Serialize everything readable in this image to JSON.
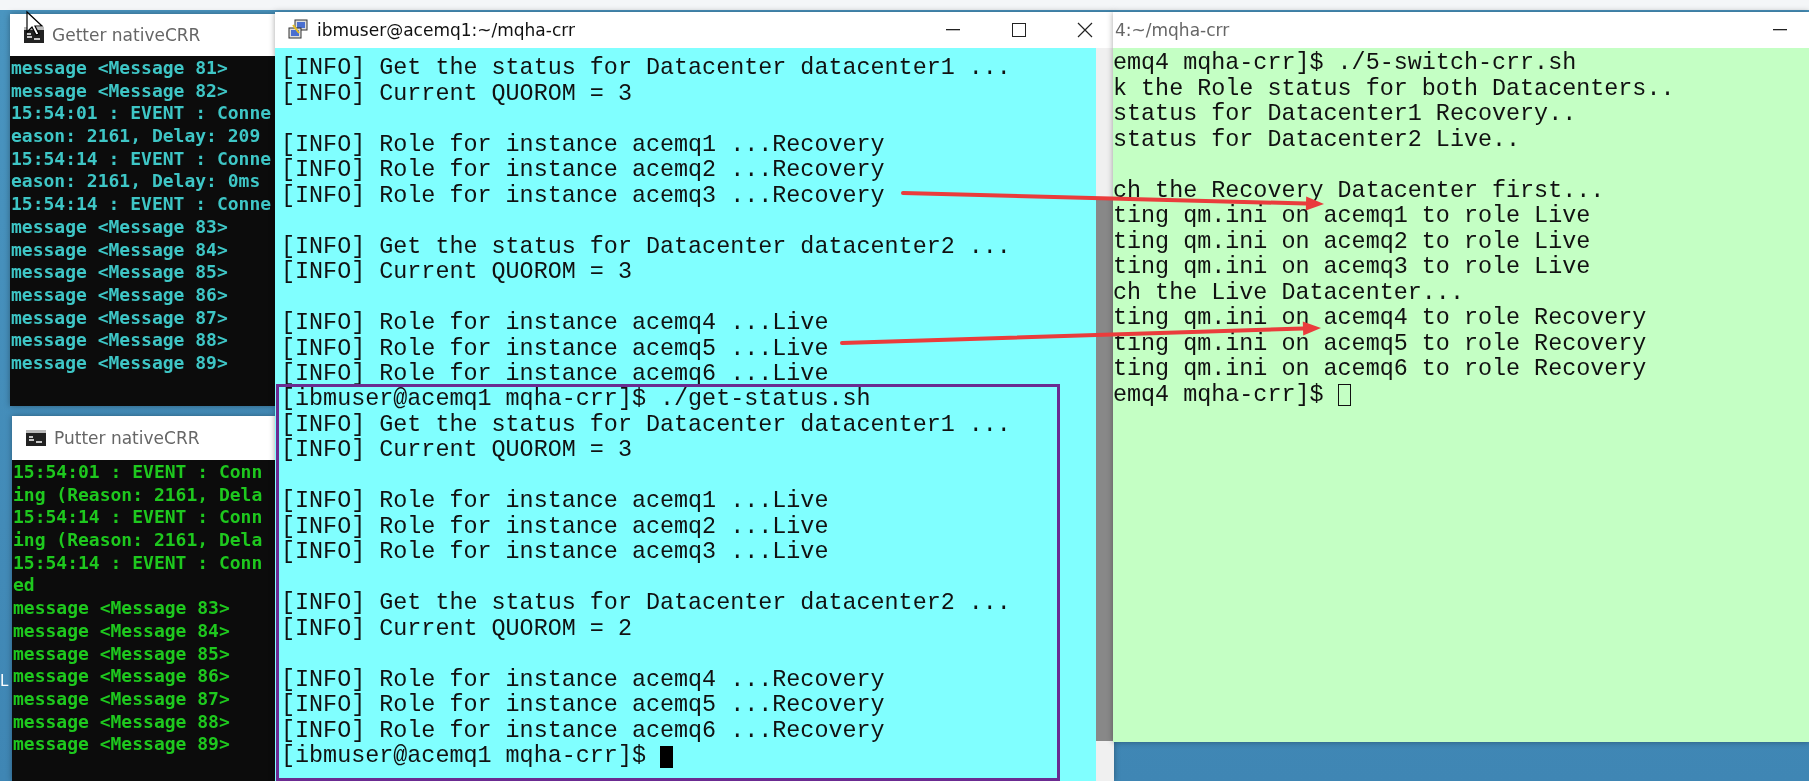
{
  "desktop": {
    "label": "L"
  },
  "windows": [
    {
      "kind": "console",
      "title": "Getter nativeCRR",
      "lines": [
        "message <Message 81>",
        "message <Message 82>",
        "15:54:01 : EVENT : Conne",
        "eason: 2161, Delay: 209",
        "15:54:14 : EVENT : Conne",
        "eason: 2161, Delay: 0ms",
        "15:54:14 : EVENT : Conne",
        "message <Message 83>",
        "message <Message 84>",
        "message <Message 85>",
        "message <Message 86>",
        "message <Message 87>",
        "message <Message 88>",
        "message <Message 89>"
      ]
    },
    {
      "kind": "console",
      "title": "Putter nativeCRR",
      "lines": [
        "15:54:01 : EVENT : Conn",
        "ing (Reason: 2161, Dela",
        "15:54:14 : EVENT : Conn",
        "ing (Reason: 2161, Dela",
        "15:54:14 : EVENT : Conn",
        "ed",
        "message <Message 83>",
        "message <Message 84>",
        "message <Message 85>",
        "message <Message 86>",
        "message <Message 87>",
        "message <Message 88>",
        "message <Message 89>"
      ]
    },
    {
      "kind": "putty",
      "title": "ibmuser@acemq1:~/mqha-crr",
      "color": "#80ffff",
      "blocks": [
        [
          "[INFO] Get the status for Datacenter datacenter1 ...",
          "[INFO] Current QUOROM = 3"
        ],
        [
          "[INFO] Role for instance acemq1 ...Recovery",
          "[INFO] Role for instance acemq2 ...Recovery",
          "[INFO] Role for instance acemq3 ...Recovery"
        ],
        [
          "[INFO] Get the status for Datacenter datacenter2 ...",
          "[INFO] Current QUOROM = 3"
        ],
        [
          "[INFO] Role for instance acemq4 ...Live",
          "[INFO] Role for instance acemq5 ...Live",
          "[INFO] Role for instance acemq6 ...Live"
        ]
      ],
      "highlighted_blocks": [
        [
          "[ibmuser@acemq1 mqha-crr]$ ./get-status.sh",
          "[INFO] Get the status for Datacenter datacenter1 ...",
          "[INFO] Current QUOROM = 3"
        ],
        [
          "[INFO] Role for instance acemq1 ...Live",
          "[INFO] Role for instance acemq2 ...Live",
          "[INFO] Role for instance acemq3 ...Live"
        ],
        [
          "[INFO] Get the status for Datacenter datacenter2 ...",
          "[INFO] Current QUOROM = 2"
        ],
        [
          "[INFO] Role for instance acemq4 ...Recovery",
          "[INFO] Role for instance acemq5 ...Recovery",
          "[INFO] Role for instance acemq6 ...Recovery",
          "[ibmuser@acemq1 mqha-crr]$"
        ]
      ]
    },
    {
      "kind": "terminal",
      "title": "4:~/mqha-crr",
      "color": "#c4ffc4",
      "blocks": [
        [
          "emq4 mqha-crr]$ ./5-switch-crr.sh",
          "k the Role status for both Datacenters..",
          "status for Datacenter1 Recovery..",
          "status for Datacenter2 Live.."
        ],
        [
          "ch the Recovery Datacenter first...",
          "ting qm.ini on acemq1 to role Live",
          "ting qm.ini on acemq2 to role Live",
          "ting qm.ini on acemq3 to role Live",
          "ch the Live Datacenter...",
          "ting qm.ini on acemq4 to role Recovery",
          "ting qm.ini on acemq5 to role Recovery",
          "ting qm.ini on acemq6 to role Recovery",
          "emq4 mqha-crr]$"
        ]
      ]
    }
  ]
}
